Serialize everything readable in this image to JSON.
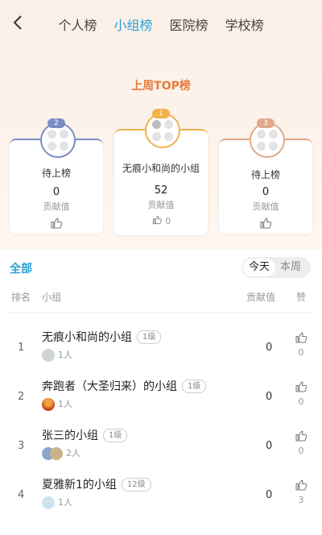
{
  "tabs": [
    {
      "label": "个人榜"
    },
    {
      "label": "小组榜"
    },
    {
      "label": "医院榜"
    },
    {
      "label": "学校榜"
    }
  ],
  "subtitle": "上周TOP榜",
  "podium": {
    "first": {
      "rank": "1",
      "name": "无痕小和尚的小组",
      "value": "52",
      "value_label": "贡献值",
      "likes": "0"
    },
    "second": {
      "rank": "2",
      "name": "待上榜",
      "value": "0",
      "value_label": "贡献值"
    },
    "third": {
      "rank": "3",
      "name": "待上榜",
      "value": "0",
      "value_label": "贡献值"
    }
  },
  "list": {
    "filter_label": "全部",
    "toggle": {
      "active": "今天",
      "inactive": "本周"
    },
    "headers": {
      "rank": "排名",
      "group": "小组",
      "value": "贡献值",
      "likes": "赞"
    },
    "rows": [
      {
        "rank": "1",
        "name": "无痕小和尚的小组",
        "level": "1级",
        "members": "1人",
        "value": "0",
        "likes": "0"
      },
      {
        "rank": "2",
        "name": "奔跑者（大圣归来）的小组",
        "level": "1级",
        "members": "1人",
        "value": "0",
        "likes": "0"
      },
      {
        "rank": "3",
        "name": "张三的小组",
        "level": "1级",
        "members": "2人",
        "value": "0",
        "likes": "0"
      },
      {
        "rank": "4",
        "name": "夏雅新1的小组",
        "level": "12级",
        "members": "1人",
        "value": "0",
        "likes": "3"
      }
    ]
  },
  "colors": {
    "accent": "#2aa0d6",
    "orange": "#e57a3f",
    "gold": "#f0b34a",
    "blue": "#7b8bc4",
    "bronze": "#e0a98a"
  }
}
